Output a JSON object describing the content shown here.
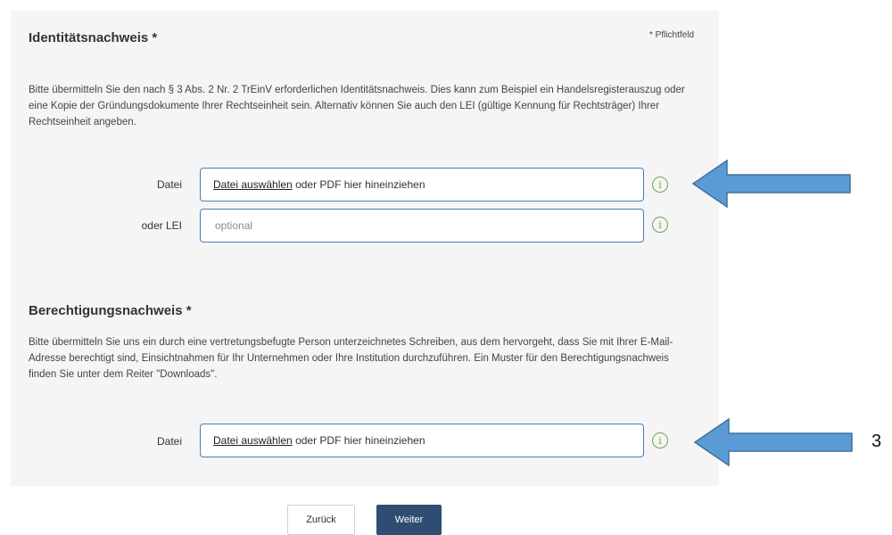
{
  "identity": {
    "title": "Identitätsnachweis *",
    "required_note": "* Pflichtfeld",
    "description": "Bitte übermitteln Sie den nach § 3 Abs. 2 Nr. 2 TrEinV erforderlichen Identitätsnachweis. Dies kann zum Beispiel ein Handelsregisterauszug oder eine Kopie der Gründungsdokumente Ihrer Rechtseinheit sein. Alternativ können Sie auch den LEI (gültige Kennung für Rechtsträger) Ihrer Rechtseinheit angeben.",
    "file_label": "Datei",
    "file_link": "Datei auswählen",
    "file_hint": " oder PDF hier hineinziehen",
    "lei_label": "oder LEI",
    "lei_placeholder": "optional"
  },
  "authorization": {
    "title": "Berechtigungsnachweis *",
    "description": "Bitte übermitteln Sie uns ein durch eine vertretungsbefugte Person unterzeichnetes Schreiben, aus dem hervorgeht, dass Sie mit Ihrer E-Mail-Adresse berechtigt sind, Einsichtnahmen für Ihr Unternehmen oder Ihre Institution durchzuführen. Ein Muster für den Berechtigungsnachweis finden Sie unter dem Reiter \"Downloads\".",
    "file_label": "Datei",
    "file_link": "Datei auswählen",
    "file_hint": " oder PDF hier hineinziehen"
  },
  "buttons": {
    "back": "Zurück",
    "next": "Weiter"
  },
  "icons": {
    "info": "info-circle-icon",
    "info_color": "#6aa84f",
    "arrow": "left-arrow-annotation",
    "arrow_color": "#5b9bd5"
  },
  "annotation": {
    "label": "3"
  }
}
